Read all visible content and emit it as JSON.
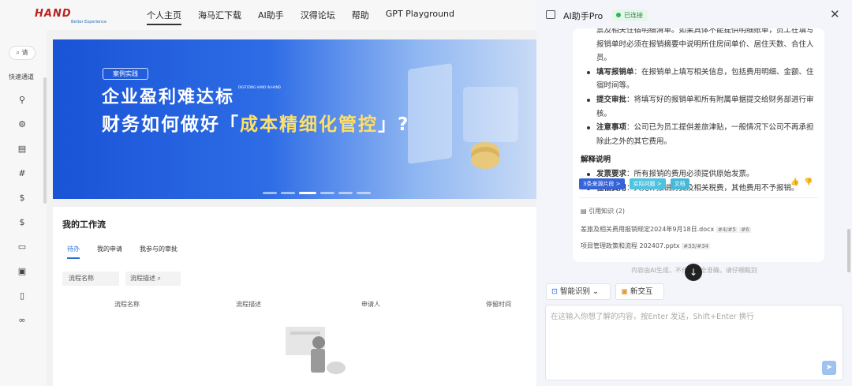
{
  "topnav": {
    "logo": "HAND",
    "logo_sub": "Better Experience",
    "items": [
      "个人主页",
      "海马汇下载",
      "AI助手",
      "汉得论坛",
      "帮助",
      "GPT Playground"
    ]
  },
  "sidebar": {
    "search": "请",
    "quick_label": "快速通道",
    "icons": [
      "user-icon",
      "settings-icon",
      "document-icon",
      "hash-icon",
      "finance-icon",
      "finance-icon",
      "folder-icon",
      "search-doc-icon",
      "book-icon",
      "link-icon"
    ]
  },
  "banner": {
    "tag": "案例实践",
    "line1": "企业盈利难达标",
    "line2_a": "财务如何做好「",
    "line2_b": "成本精细化管控",
    "line2_c": "」?",
    "mark": "DIGITIZING HAND IN HAND"
  },
  "workflow": {
    "title": "我的工作流",
    "tabs": [
      "待办",
      "我的申请",
      "我参与的审批"
    ],
    "filter_name": "流程名称",
    "filter_desc": "流程描述",
    "columns": [
      "流程名称",
      "流程描述",
      "申请人",
      "停留时间"
    ]
  },
  "panel": {
    "title": "AI助手Pro",
    "status": "已连接",
    "message": {
      "intro": "票及相关住宿明细清单。如果具体不能提供明细账单，员工在填写报销单时必须在报销摘要中说明所住房间单价、居住天数、合住人员。",
      "bullets1": [
        {
          "bold": "填写报销单",
          "text": "：在报销单上填写相关信息，包括费用明细、金额、住宿时间等。"
        },
        {
          "bold": "提交审批",
          "text": "：将填写好的报销单和所有附属单据提交给财务部进行审核。"
        },
        {
          "bold": "注意事项",
          "text": "：公司已为员工提供差旅津贴，一般情况下公司不再承担除此之外的其它费用。"
        }
      ],
      "section": "解释说明",
      "bullets2": [
        {
          "bold": "发票要求",
          "text": "：所有报销的费用必须提供原始发票。"
        },
        {
          "bold": "住宿费用",
          "text": "：只允许报销房费及相关税费，其他费用不予报销。"
        }
      ],
      "chips": [
        "3条来源片段 >",
        "实际问题 >",
        "文档"
      ],
      "cite_header": "引用知识 (2)",
      "citations": [
        {
          "name": "差旅及相关费用报销规定2024年9月18日.docx",
          "refs": [
            "#4/#5",
            "#6"
          ]
        },
        {
          "name": "项目管理政策和流程 202407.pptx",
          "refs": [
            "#33/#34"
          ]
        }
      ]
    },
    "disclaimer": "内容由AI生成，不代表完全准确，请仔细甄别",
    "tools": {
      "smart": "智能识别",
      "new_chat": "新交互"
    },
    "input_placeholder": "在这输入你想了解的内容，按Enter 发送，Shift+Enter 换行"
  }
}
